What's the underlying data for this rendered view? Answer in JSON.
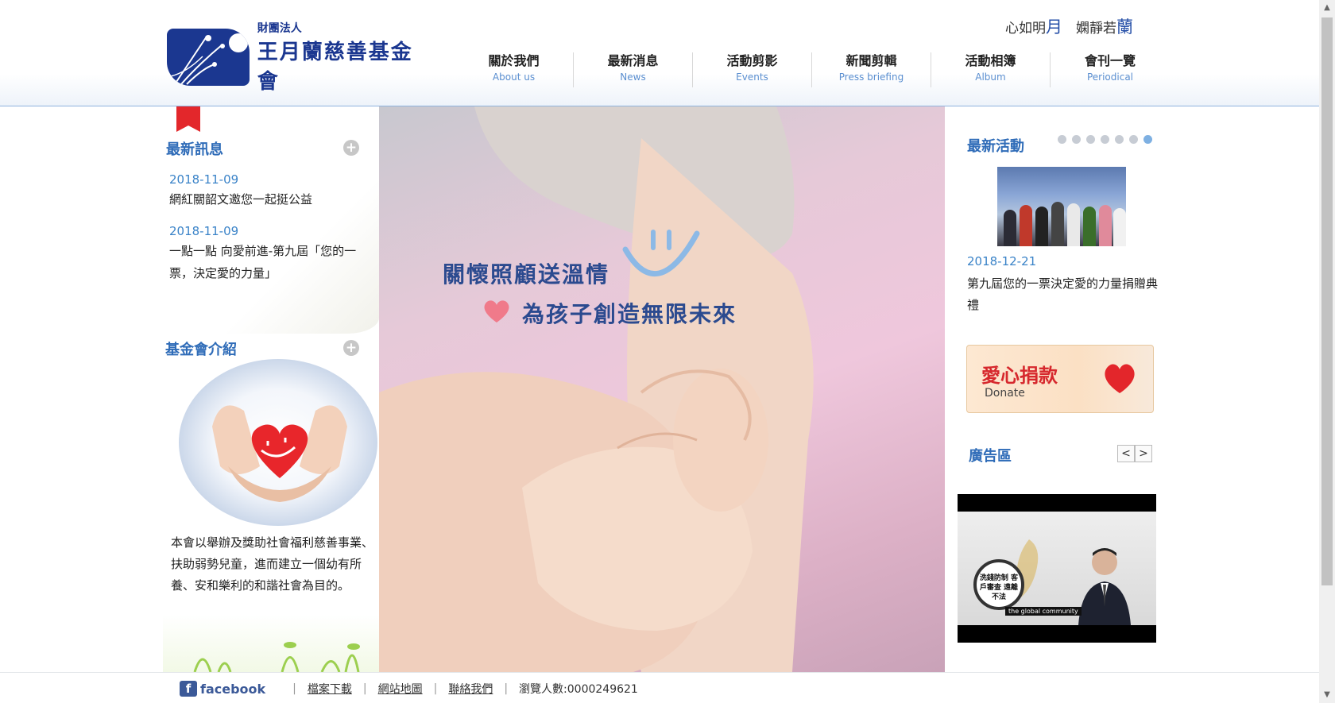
{
  "header": {
    "logo_sub": "財團法人",
    "logo_name": "王月蘭慈善基金會",
    "motto_a": "心如明",
    "motto_b": "月",
    "motto_c": "　嫻靜若",
    "motto_d": "蘭"
  },
  "nav": [
    {
      "zh": "關於我們",
      "en": "About us"
    },
    {
      "zh": "最新消息",
      "en": "News"
    },
    {
      "zh": "活動剪影",
      "en": "Events"
    },
    {
      "zh": "新聞剪輯",
      "en": "Press briefing"
    },
    {
      "zh": "活動相簿",
      "en": "Album"
    },
    {
      "zh": "會刊一覽",
      "en": "Periodical"
    }
  ],
  "news": {
    "title": "最新訊息",
    "plus": "+",
    "items": [
      {
        "date": "2018-11-09",
        "text": "網紅關韶文邀您一起挺公益"
      },
      {
        "date": "2018-11-09",
        "text": "一點一點 向愛前進-第九屆「您的一票，決定愛的力量」"
      }
    ]
  },
  "intro": {
    "title": "基金會介紹",
    "plus": "+",
    "text": "本會以舉辦及獎助社會福利慈善事業、扶助弱勢兒童，進而建立一個幼有所養、安和樂利的和諧社會為目的。"
  },
  "hero": {
    "line1": "關懷照顧送溫情",
    "line2": "為孩子創造無限未來"
  },
  "activities": {
    "title": "最新活動",
    "dot_count": 7,
    "active_dot": 7,
    "date": "2018-12-21",
    "text": "第九屆您的一票決定愛的力量捐贈典禮"
  },
  "donate": {
    "zh": "愛心捐款",
    "en": "Donate"
  },
  "ads": {
    "title": "廣告區",
    "prev": "<",
    "next": ">",
    "badge": "洗錢防制 客戶審查 遠離不法",
    "caption": "the global community"
  },
  "footer": {
    "fb_icon": "f",
    "fb_label": "facebook",
    "links": [
      "檔案下載",
      "網站地圖",
      "聯絡我們"
    ],
    "visitors": "瀏覽人數:0000249621"
  },
  "colors": {
    "brand_blue": "#1b3790",
    "link_blue": "#2f6cb8",
    "date_blue": "#3a83c8",
    "donate_red": "#d6282d"
  }
}
